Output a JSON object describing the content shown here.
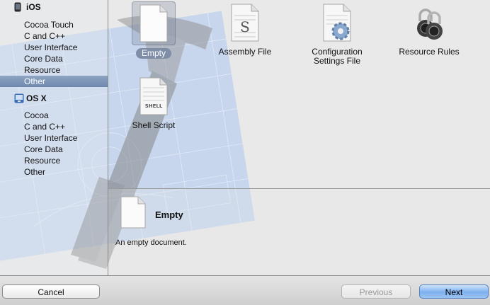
{
  "sidebar": {
    "platforms": [
      {
        "name": "iOS",
        "icon": "iphone-icon",
        "items": [
          {
            "label": "Cocoa Touch",
            "selected": false
          },
          {
            "label": "C and C++",
            "selected": false
          },
          {
            "label": "User Interface",
            "selected": false
          },
          {
            "label": "Core Data",
            "selected": false
          },
          {
            "label": "Resource",
            "selected": false
          },
          {
            "label": "Other",
            "selected": true
          }
        ]
      },
      {
        "name": "OS X",
        "icon": "mac-icon",
        "items": [
          {
            "label": "Cocoa",
            "selected": false
          },
          {
            "label": "C and C++",
            "selected": false
          },
          {
            "label": "User Interface",
            "selected": false
          },
          {
            "label": "Core Data",
            "selected": false
          },
          {
            "label": "Resource",
            "selected": false
          },
          {
            "label": "Other",
            "selected": false
          }
        ]
      }
    ]
  },
  "templates": [
    {
      "label": "Empty",
      "icon": "empty-document-icon",
      "selected": true
    },
    {
      "label": "Assembly File",
      "icon": "assembly-file-icon",
      "icon_text": "S",
      "selected": false
    },
    {
      "label": "Configuration Settings File",
      "icon": "configuration-settings-icon",
      "selected": false
    },
    {
      "label": "Resource Rules",
      "icon": "padlock-icon",
      "selected": false
    },
    {
      "label": "Shell Script",
      "icon": "shell-script-icon",
      "icon_text": "SHELL",
      "selected": false
    }
  ],
  "detail": {
    "icon": "empty-document-icon",
    "title": "Empty",
    "description": "An empty document."
  },
  "buttons": {
    "cancel": "Cancel",
    "previous": "Previous",
    "next": "Next",
    "previous_enabled": false
  },
  "colors": {
    "selection": "#7f8ea6",
    "default_button": "#7db0ee",
    "blueprint": "#a9c4ea"
  }
}
